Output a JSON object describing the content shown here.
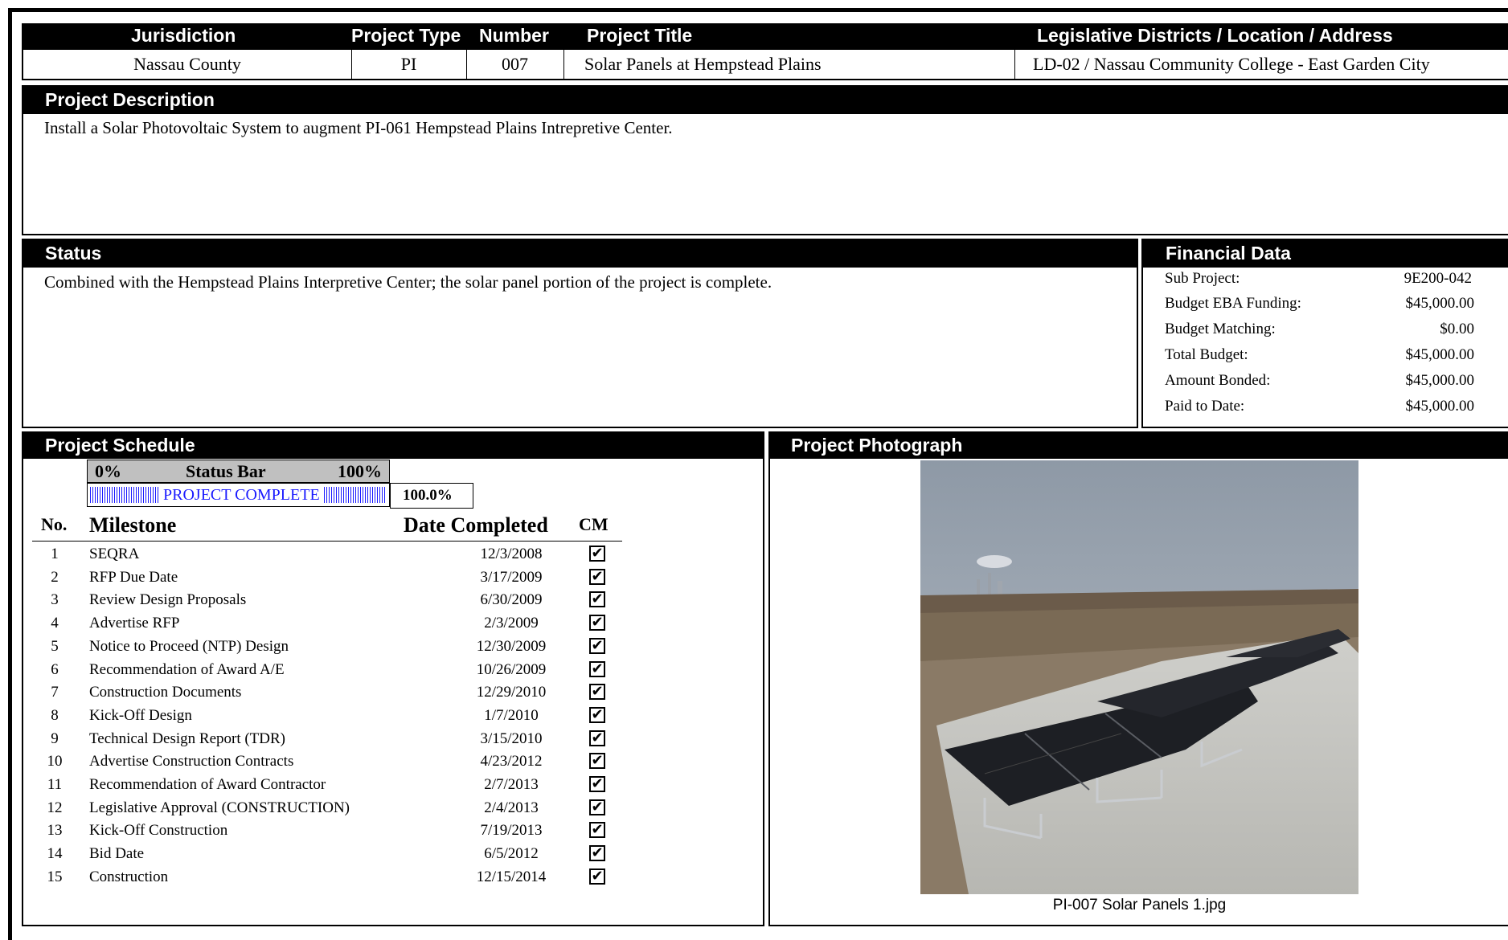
{
  "header": {
    "columns": {
      "jurisdiction": "Jurisdiction",
      "project_type": "Project Type",
      "number": "Number",
      "project_title": "Project Title",
      "location": "Legislative Districts / Location / Address"
    },
    "row": {
      "jurisdiction": "Nassau County",
      "project_type": "PI",
      "number": "007",
      "project_title": "Solar Panels at Hempstead Plains",
      "location": "LD-02 / Nassau Community College - East Garden City"
    }
  },
  "description": {
    "title": "Project Description",
    "text": "Install a Solar Photovoltaic System to augment PI-061 Hempstead Plains Intrepretive Center."
  },
  "status": {
    "title": "Status",
    "text": "Combined with the Hempstead Plains Interpretive Center; the solar panel portion of the project is complete."
  },
  "financial": {
    "title": "Financial Data",
    "rows": [
      {
        "label": "Sub Project:",
        "value": "9E200-042"
      },
      {
        "label": "Budget EBA Funding:",
        "value": "$45,000.00"
      },
      {
        "label": "Budget Matching:",
        "value": "$0.00"
      },
      {
        "label": "Total Budget:",
        "value": "$45,000.00"
      },
      {
        "label": "Amount Bonded:",
        "value": "$45,000.00"
      },
      {
        "label": "Paid to Date:",
        "value": "$45,000.00"
      }
    ]
  },
  "schedule": {
    "title": "Project Schedule",
    "status_bar": {
      "left_label": "0%",
      "center_label": "Status Bar",
      "right_label": "100%",
      "bar_text": "PROJECT COMPLETE",
      "percent_text": "100.0%",
      "progress_fraction": 1.0,
      "bar_color": "#1a1aff"
    },
    "columns": {
      "no": "No.",
      "milestone": "Milestone",
      "date": "Date Completed",
      "cm": "CM"
    },
    "milestones": [
      {
        "no": "1",
        "name": "SEQRA",
        "date": "12/3/2008",
        "cm": "✔"
      },
      {
        "no": "2",
        "name": "RFP Due Date",
        "date": "3/17/2009",
        "cm": "✔"
      },
      {
        "no": "3",
        "name": "Review Design Proposals",
        "date": "6/30/2009",
        "cm": "✔"
      },
      {
        "no": "4",
        "name": "Advertise RFP",
        "date": "2/3/2009",
        "cm": "✔"
      },
      {
        "no": "5",
        "name": "Notice to Proceed (NTP) Design",
        "date": "12/30/2009",
        "cm": "✔"
      },
      {
        "no": "6",
        "name": "Recommendation of Award A/E",
        "date": "10/26/2009",
        "cm": "✔"
      },
      {
        "no": "7",
        "name": "Construction Documents",
        "date": "12/29/2010",
        "cm": "✔"
      },
      {
        "no": "8",
        "name": "Kick-Off Design",
        "date": "1/7/2010",
        "cm": "✔"
      },
      {
        "no": "9",
        "name": "Technical Design Report (TDR)",
        "date": "3/15/2010",
        "cm": "✔"
      },
      {
        "no": "10",
        "name": "Advertise Construction Contracts",
        "date": "4/23/2012",
        "cm": "✔"
      },
      {
        "no": "11",
        "name": "Recommendation of Award Contractor",
        "date": "2/7/2013",
        "cm": "✔"
      },
      {
        "no": "12",
        "name": "Legislative Approval (CONSTRUCTION)",
        "date": "2/4/2013",
        "cm": "✔"
      },
      {
        "no": "13",
        "name": "Kick-Off Construction",
        "date": "7/19/2013",
        "cm": "✔"
      },
      {
        "no": "14",
        "name": "Bid Date",
        "date": "6/5/2012",
        "cm": "✔"
      },
      {
        "no": "15",
        "name": "Construction",
        "date": "12/15/2014",
        "cm": "✔"
      }
    ]
  },
  "photo": {
    "title": "Project Photograph",
    "caption": "PI-007 Solar Panels 1.jpg"
  }
}
